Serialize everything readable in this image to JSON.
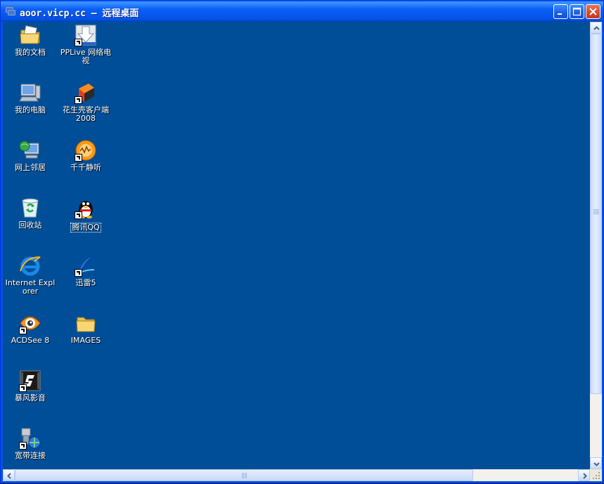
{
  "window": {
    "title_host": "aoor.vicp.cc",
    "title_sep": " – ",
    "title_app": "远程桌面",
    "buttons": {
      "minimize": "minimize",
      "maximize": "maximize",
      "close": "close"
    }
  },
  "desktop": {
    "background": "#004e98",
    "icons": [
      {
        "id": "my-documents",
        "label": "我的文档",
        "icon": "folder-documents-icon"
      },
      {
        "id": "pplive",
        "label": "PPLive 网络电视",
        "icon": "pplive-icon",
        "shortcut": true
      },
      {
        "id": "my-computer",
        "label": "我的电脑",
        "icon": "computer-icon"
      },
      {
        "id": "oray",
        "label": "花生壳客户端 2008",
        "icon": "oray-icon",
        "shortcut": true
      },
      {
        "id": "network-places",
        "label": "网上邻居",
        "icon": "network-places-icon"
      },
      {
        "id": "ttplayer",
        "label": "千千静听",
        "icon": "ttplayer-icon",
        "shortcut": true
      },
      {
        "id": "recycle-bin",
        "label": "回收站",
        "icon": "recycle-bin-icon"
      },
      {
        "id": "qq",
        "label": "腾讯QQ",
        "icon": "qq-penguin-icon",
        "shortcut": true,
        "selected": true
      },
      {
        "id": "ie",
        "label": "Internet Explorer",
        "icon": "internet-explorer-icon"
      },
      {
        "id": "thunder",
        "label": "迅雷5",
        "icon": "thunder-icon",
        "shortcut": true
      },
      {
        "id": "acdsee",
        "label": "ACDSee 8",
        "icon": "acdsee-icon",
        "shortcut": true
      },
      {
        "id": "images",
        "label": "IMAGES",
        "icon": "folder-icon"
      },
      {
        "id": "storm",
        "label": "暴风影音",
        "icon": "storm-player-icon",
        "shortcut": true
      },
      {
        "id": "broadband",
        "label": "宽带连接",
        "icon": "broadband-connection-icon",
        "shortcut": true
      }
    ]
  }
}
